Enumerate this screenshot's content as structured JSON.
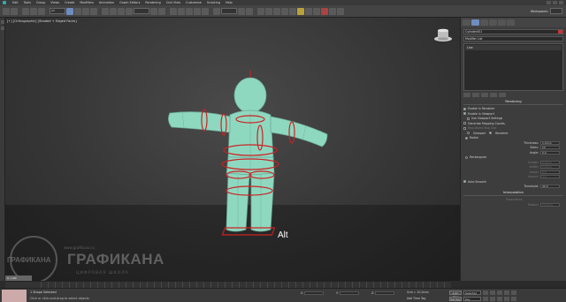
{
  "menu": {
    "items": [
      "Edit",
      "Tools",
      "Group",
      "Views",
      "Create",
      "Modifiers",
      "Animation",
      "Graph Editors",
      "Rendering",
      "Civil View",
      "Customize",
      "Scripting",
      "Help"
    ]
  },
  "toolbar": {
    "selection_filter": "All",
    "workspace_label": "Workspaces:",
    "workspace_value": "Default"
  },
  "viewport": {
    "label": "[+] [Orthographic] [Shaded + Edged Faces]",
    "overlay_text": "Alt",
    "watermark": {
      "url": "www.grafikana.ru",
      "name": "ГРАФИКАНА",
      "subtitle": "ЦИФРОВАЯ ШКОЛА",
      "circle_text": "ГРАФИКАНА"
    }
  },
  "command_panel": {
    "object_name": "Cylinder001",
    "modifier_list": "Modifier List",
    "stack_item": "Line",
    "rendering": {
      "title": "Rendering",
      "enable_in_renderer": "Enable In Renderer",
      "enable_in_viewport": "Enable In Viewport",
      "use_viewport_settings": "Use Viewport Settings",
      "gen_mapping_coords": "Generate Mapping Coords.",
      "real_world_map_size": "Real-World Map Size",
      "viewport_opt": "Viewport",
      "renderer_opt": "Renderer",
      "radial": "Radial",
      "thickness_label": "Thickness:",
      "thickness_value": "1,0mm",
      "sides_label": "Sides:",
      "sides_value": "12",
      "angle_label": "Angle:",
      "angle_value": "0,0",
      "rectangular": "Rectangular",
      "length_label": "Length:",
      "length_value": "6,0mm",
      "width_label": "Width:",
      "width_value": "2,0mm",
      "angle2_label": "Angle:",
      "angle2_value": "0,0",
      "aspect_label": "Aspect:",
      "aspect_value": "3,0",
      "auto_smooth": "Auto Smooth",
      "threshold_label": "Threshold:",
      "threshold_value": "40,0"
    },
    "interpolation": {
      "title": "Interpolation",
      "parameters": "Parameters",
      "radius_label": "Radius:",
      "radius_value": "20,0mm"
    }
  },
  "timeline": {
    "slider": "0 / 100"
  },
  "status": {
    "selected": "1 Shape Selected",
    "prompt": "Click or click-and-drag to select objects",
    "x_label": "X:",
    "y_label": "Y:",
    "z_label": "Z:",
    "grid": "Grid = 10,0mm",
    "add_time_tag": "Add Time Tag",
    "auto_key": "Auto Key",
    "set_key": "Set Key",
    "selected_option": "Selected",
    "key_filters": "Key Filters..."
  },
  "colors": {
    "model": "#8fd8c0",
    "rings": "#cc2222",
    "accent": "#6d8cbf"
  }
}
